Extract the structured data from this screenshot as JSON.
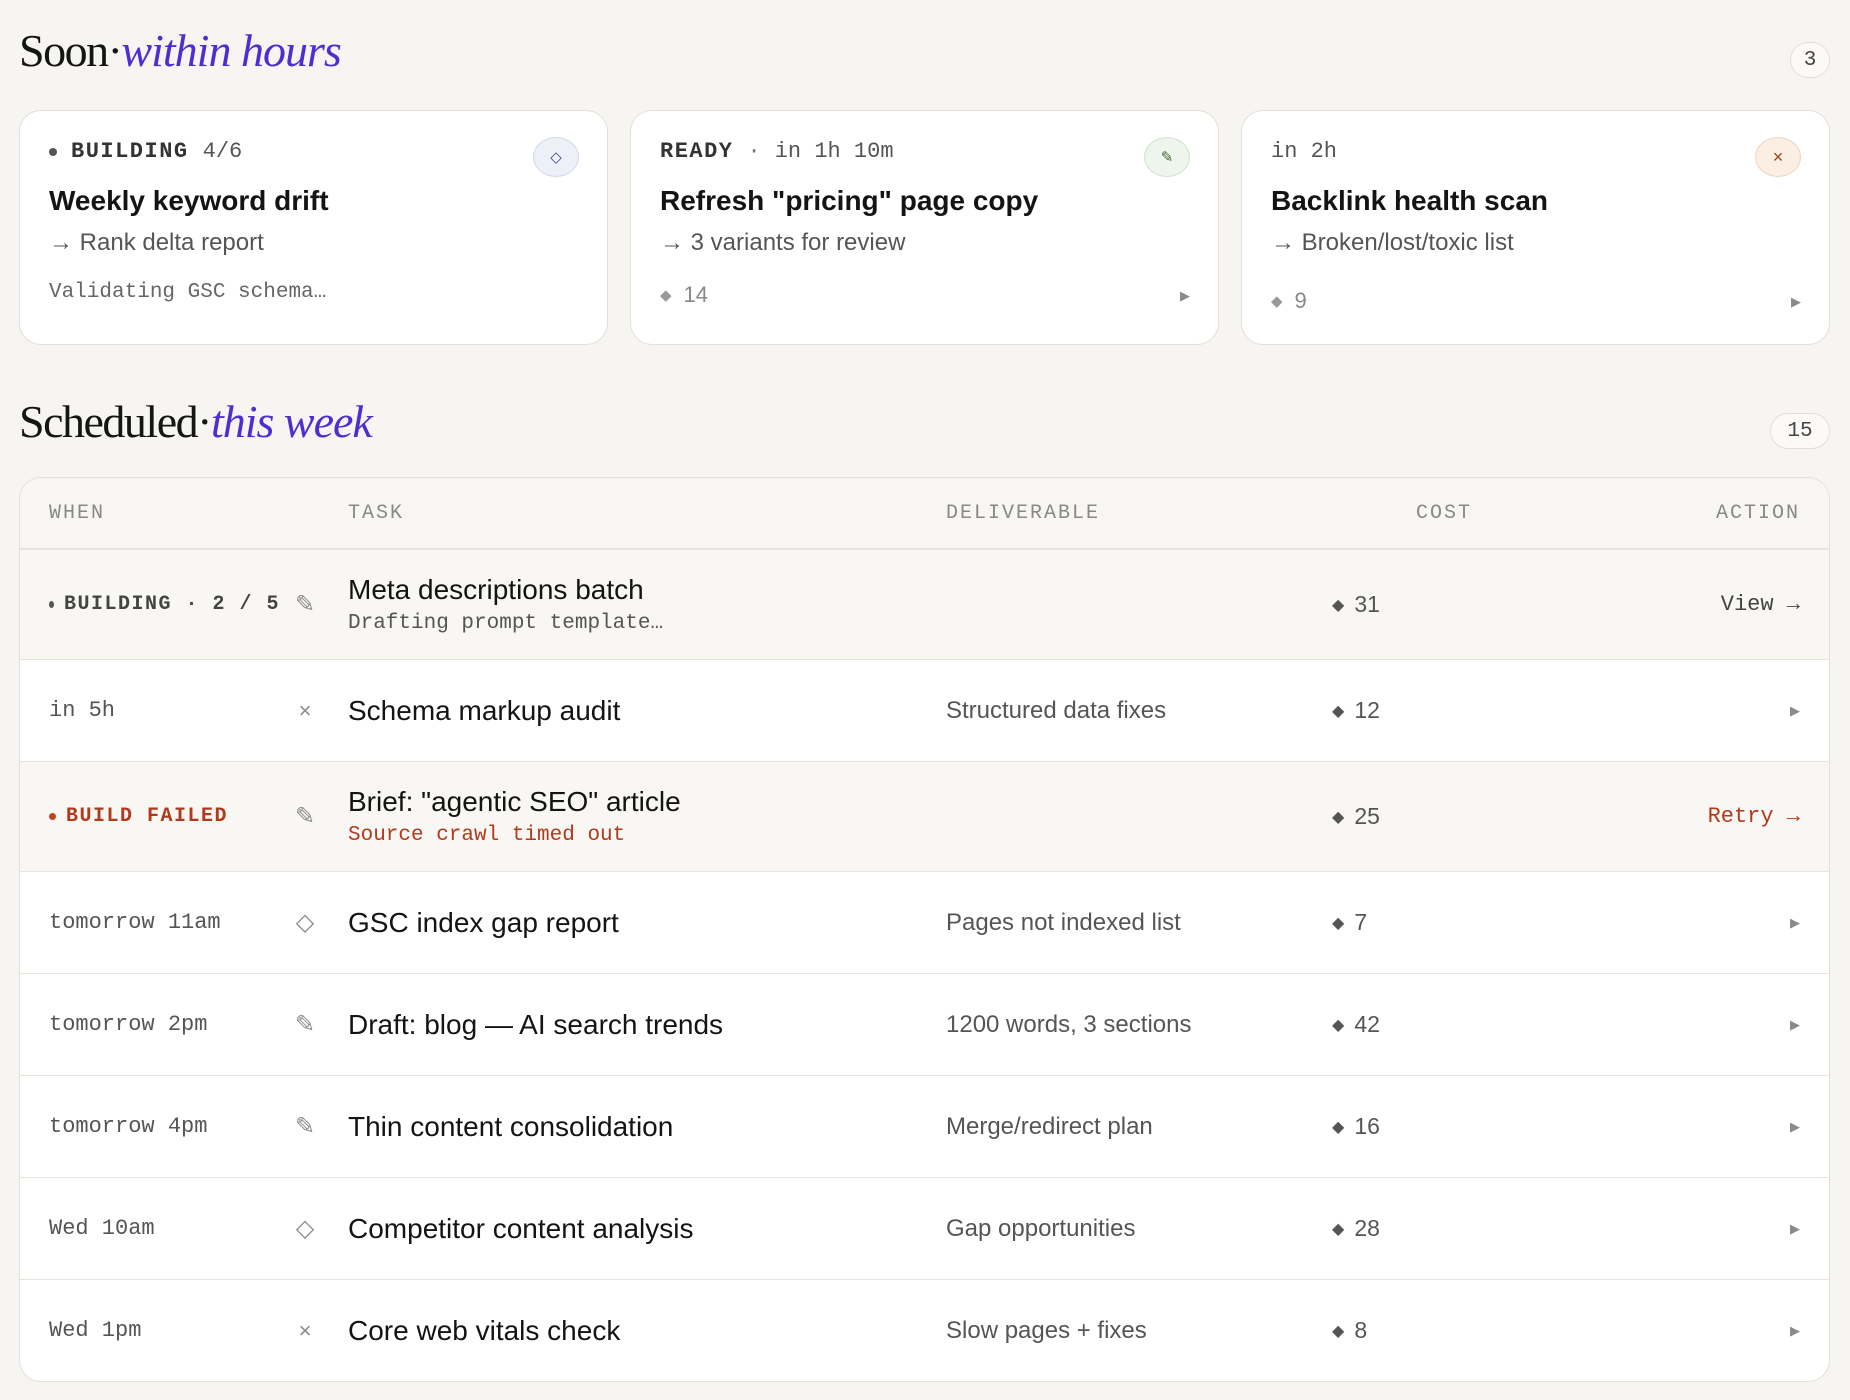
{
  "soon": {
    "title": "Soon",
    "dot": "·",
    "accent": "within hours",
    "count": "3",
    "cards": [
      {
        "status": "BUILDING",
        "meta": "4/6",
        "icon": "diamond-icon",
        "icon_glyph": "◇",
        "title": "Weekly keyword drift",
        "subtitle": "→ Rank delta report",
        "footer": "Validating GSC schema…"
      },
      {
        "status": "READY",
        "sep": "·",
        "meta": "in 1h 10m",
        "icon": "pencil-icon",
        "icon_glyph": "✎",
        "title": "Refresh \"pricing\" page copy",
        "subtitle": "→ 3 variants for review",
        "cost": "14"
      },
      {
        "meta": "in 2h",
        "icon": "close-icon",
        "icon_glyph": "×",
        "title": "Backlink health scan",
        "subtitle": "→ Broken/lost/toxic list",
        "cost": "9"
      }
    ]
  },
  "scheduled": {
    "title": "Scheduled",
    "dot": "·",
    "accent": "this week",
    "count": "15",
    "columns": {
      "when": "WHEN",
      "task": "TASK",
      "deliverable": "DELIVERABLE",
      "cost": "COST",
      "action": "ACTION"
    },
    "rows": [
      {
        "when_status": "BUILDING · 2 / 5",
        "kind": "pencil-icon",
        "kind_glyph": "✎",
        "task": "Meta descriptions batch",
        "task_sub": "Drafting prompt template…",
        "deliverable": "",
        "cost": "31",
        "action": "View →"
      },
      {
        "when": "in 5h",
        "kind": "close-icon",
        "kind_glyph": "×",
        "task": "Schema markup audit",
        "deliverable": "Structured data fixes",
        "cost": "12"
      },
      {
        "when_status": "BUILD FAILED",
        "failed": true,
        "kind": "pencil-icon",
        "kind_glyph": "✎",
        "task": "Brief: \"agentic SEO\" article",
        "task_sub": "Source crawl timed out",
        "deliverable": "",
        "cost": "25",
        "action": "Retry →"
      },
      {
        "when": "tomorrow 11am",
        "kind": "diamond-icon",
        "kind_glyph": "◇",
        "task": "GSC index gap report",
        "deliverable": "Pages not indexed list",
        "cost": "7"
      },
      {
        "when": "tomorrow 2pm",
        "kind": "pencil-icon",
        "kind_glyph": "✎",
        "task": "Draft: blog — AI search trends",
        "deliverable": "1200 words, 3 sections",
        "cost": "42"
      },
      {
        "when": "tomorrow 4pm",
        "kind": "pencil-icon",
        "kind_glyph": "✎",
        "task": "Thin content consolidation",
        "deliverable": "Merge/redirect plan",
        "cost": "16"
      },
      {
        "when": "Wed 10am",
        "kind": "diamond-icon",
        "kind_glyph": "◇",
        "task": "Competitor content analysis",
        "deliverable": "Gap opportunities",
        "cost": "28"
      },
      {
        "when": "Wed 1pm",
        "kind": "close-icon",
        "kind_glyph": "×",
        "task": "Core web vitals check",
        "deliverable": "Slow pages + fixes",
        "cost": "8"
      }
    ]
  },
  "glyphs": {
    "gem": "◆",
    "play": "▶"
  },
  "colors": {
    "accent": "#4b2fd0",
    "failed": "#b03a1b",
    "background": "#f6f5f2"
  }
}
